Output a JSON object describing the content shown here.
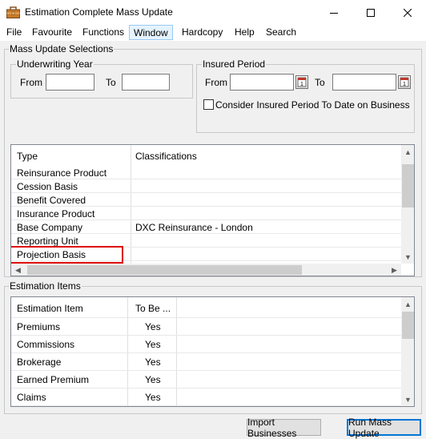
{
  "window": {
    "title": "Estimation Complete Mass Update"
  },
  "menu": [
    "File",
    "Favourite",
    "Functions",
    "Window",
    "Hardcopy",
    "Help",
    "Search"
  ],
  "mass_update": {
    "group_label": "Mass Update Selections",
    "underwriting_year": {
      "label": "Underwriting Year",
      "from_label": "From",
      "to_label": "To",
      "from_value": "",
      "to_value": ""
    },
    "insured_period": {
      "label": "Insured Period",
      "from_label": "From",
      "to_label": "To",
      "from_value": "",
      "to_value": ""
    },
    "consider_checkbox_label": "Consider Insured Period To Date on Business",
    "consider_checked": false
  },
  "classifications_grid": {
    "columns": [
      "Type",
      "Classifications"
    ],
    "rows": [
      {
        "type": "Reinsurance Product",
        "classification": ""
      },
      {
        "type": "Cession Basis",
        "classification": ""
      },
      {
        "type": "Benefit Covered",
        "classification": ""
      },
      {
        "type": "Insurance Product",
        "classification": ""
      },
      {
        "type": "Base Company",
        "classification": "DXC Reinsurance - London"
      },
      {
        "type": "Reporting Unit",
        "classification": ""
      },
      {
        "type": "Projection Basis",
        "classification": ""
      }
    ],
    "highlight_color": "#e00000"
  },
  "estimation": {
    "group_label": "Estimation Items",
    "columns": [
      "Estimation Item",
      "To Be ..."
    ],
    "rows": [
      {
        "item": "Premiums",
        "value": "Yes"
      },
      {
        "item": "Commissions",
        "value": "Yes"
      },
      {
        "item": "Brokerage",
        "value": "Yes"
      },
      {
        "item": "Earned Premium",
        "value": "Yes"
      },
      {
        "item": "Claims",
        "value": "Yes"
      }
    ]
  },
  "buttons": {
    "import": "Import Businesses",
    "run": "Run Mass Update"
  },
  "colors": {
    "focus_border": "#0078d7",
    "menu_active_bg": "#e5f3ff"
  }
}
